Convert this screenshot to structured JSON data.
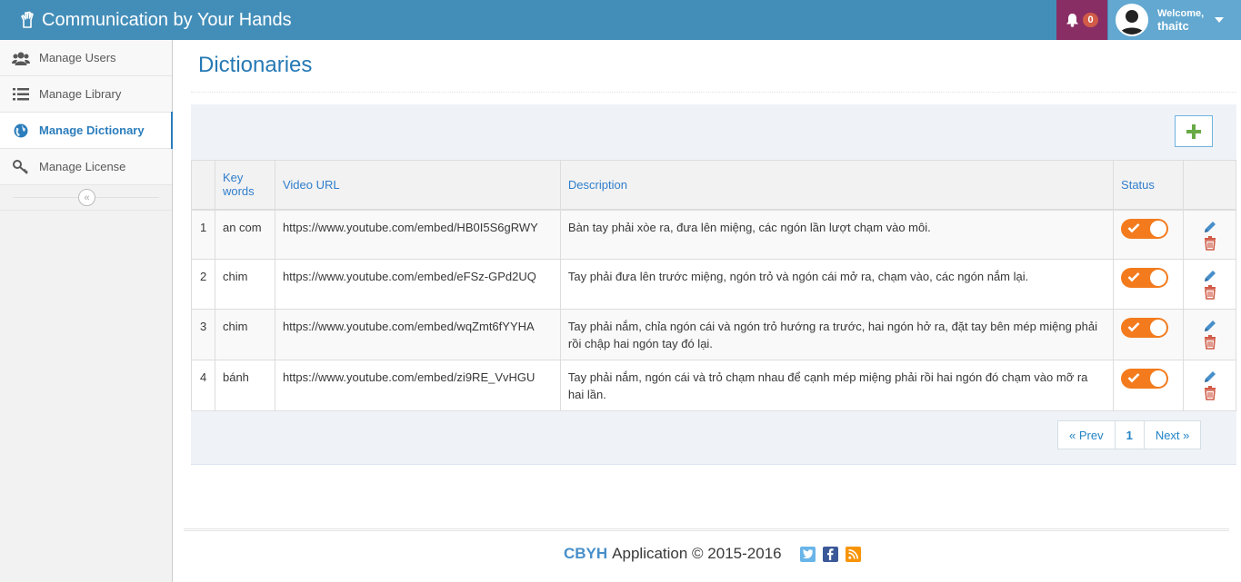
{
  "app": {
    "title": "Communication by Your Hands"
  },
  "header": {
    "notification_count": "0",
    "welcome": "Welcome,",
    "username": "thaitc"
  },
  "sidebar": {
    "items": [
      {
        "label": "Manage Users"
      },
      {
        "label": "Manage Library"
      },
      {
        "label": "Manage Dictionary"
      },
      {
        "label": "Manage License"
      }
    ]
  },
  "page": {
    "title": "Dictionaries"
  },
  "table": {
    "headers": {
      "num": "",
      "keywords": "Key words",
      "video": "Video URL",
      "description": "Description",
      "status": "Status",
      "actions": ""
    },
    "rows": [
      {
        "num": "1",
        "keyword": "an com",
        "video": "https://www.youtube.com/embed/HB0I5S6gRWY",
        "description": "Bàn tay phải xòe ra, đưa lên miệng, các ngón lần lượt chạm vào môi.",
        "status_on": true
      },
      {
        "num": "2",
        "keyword": "chim",
        "video": "https://www.youtube.com/embed/eFSz-GPd2UQ",
        "description": "Tay phải đưa lên trước miệng, ngón trỏ và ngón cái mở ra, chạm vào, các ngón nắm lại.",
        "status_on": true
      },
      {
        "num": "3",
        "keyword": "chim",
        "video": "https://www.youtube.com/embed/wqZmt6fYYHA",
        "description": "Tay phải nắm, chỉa ngón cái và ngón trỏ hướng ra trước, hai ngón hở ra, đặt tay bên mép miệng phải rồi chập hai ngón tay đó lại.",
        "status_on": true
      },
      {
        "num": "4",
        "keyword": "bánh",
        "video": "https://www.youtube.com/embed/zi9RE_VvHGU",
        "description": "Tay phải nắm, ngón cái và trỏ chạm nhau để cạnh mép miệng phải rồi hai ngón đó chạm vào mỡ ra hai lần.",
        "status_on": true
      }
    ]
  },
  "pagination": {
    "prev": "« Prev",
    "current": "1",
    "next": "Next »"
  },
  "footer": {
    "brand": "CBYH",
    "text": "Application © 2015-2016"
  },
  "colors": {
    "navbar": "#438eb9",
    "notification": "#892e65",
    "user": "#62a8d1",
    "toggle_on": "#f37b1d",
    "link": "#2679b5"
  }
}
